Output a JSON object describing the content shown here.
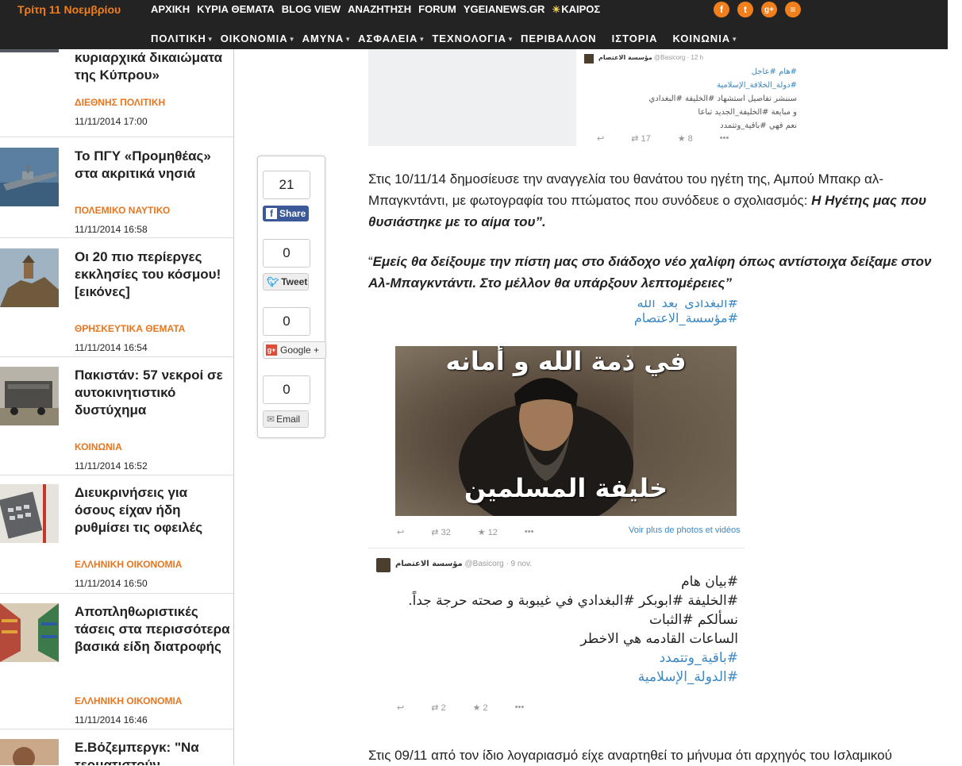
{
  "header": {
    "date": "Τρίτη 11 Νοεμβρίου",
    "nav_top": [
      "ΑΡΧΙΚΗ",
      "ΚΥΡΙΑ ΘΕΜΑΤΑ",
      "BLOG VIEW",
      "ΑΝΑΖΗΤΗΣΗ",
      "FORUM",
      "YGEIANEWS.GR"
    ],
    "weather": "ΚΑΙΡΟΣ",
    "social": [
      {
        "icon": "facebook-icon",
        "glyph": "f"
      },
      {
        "icon": "twitter-icon",
        "glyph": "t"
      },
      {
        "icon": "googleplus-icon",
        "glyph": "g+"
      },
      {
        "icon": "rss-icon",
        "glyph": "≡"
      }
    ],
    "nav_main": [
      {
        "label": "ΠΟΛΙΤΙΚΗ",
        "dropdown": true
      },
      {
        "label": "ΟΙΚΟΝΟΜΙΑ",
        "dropdown": true
      },
      {
        "label": "ΑΜΥΝΑ",
        "dropdown": true
      },
      {
        "label": "ΑΣΦΑΛΕΙΑ",
        "dropdown": true
      },
      {
        "label": "ΤΕΧΝΟΛΟΓΙΑ",
        "dropdown": true
      },
      {
        "label": "ΠΕΡΙΒΑΛΛΟΝ",
        "dropdown": false
      },
      {
        "label": "ΙΣΤΟΡΙΑ",
        "dropdown": false
      },
      {
        "label": "ΚΟΙΝΩΝΙΑ",
        "dropdown": true
      }
    ]
  },
  "sidebar": {
    "items": [
      {
        "title": "κυριαρχικά δικαιώματα της Κύπρου»",
        "category": "ΔΙΕΘΝΗΣ ΠΟΛΙΤΙΚΗ",
        "date": "11/11/2014 17:00",
        "thumb": "ship"
      },
      {
        "title": "Το ΠΓΥ «Προμηθέας» στα ακριτικά νησιά",
        "category": "ΠΟΛΕΜΙΚΟ ΝΑΥΤΙΚΟ",
        "date": "11/11/2014 16:58",
        "thumb": "warship"
      },
      {
        "title": "Οι 20 πιο περίεργες εκκλησίες του κόσμου! [εικόνες]",
        "category": "ΘΡΗΣΚΕΥΤΙΚΑ ΘΕΜΑΤΑ",
        "date": "11/11/2014 16:54",
        "thumb": "church"
      },
      {
        "title": "Πακιστάν: 57 νεκροί σε αυτοκινητιστικό δυστύχημα",
        "category": "ΚΟΙΝΩΝΙΑ",
        "date": "11/11/2014 16:52",
        "thumb": "truck"
      },
      {
        "title": "Διευκρινήσεις για όσους είχαν ήδη ρυθμίσει τις οφειλές",
        "category": "ΕΛΛΗΝΙΚΗ ΟΙΚΟΝΟΜΙΑ",
        "date": "11/11/2014 16:50",
        "thumb": "calculator"
      },
      {
        "title": "Αποπληθωριστικές τάσεις στα περισσότερα βασικά είδη διατροφής",
        "category": "ΕΛΛΗΝΙΚΗ ΟΙΚΟΝΟΜΙΑ",
        "date": "11/11/2014 16:46",
        "thumb": "supermarket"
      },
      {
        "title": "Ε.Βόζεμπεργκ: \"Να τερματιστούν",
        "category": "",
        "date": "",
        "thumb": "person"
      }
    ]
  },
  "share": {
    "facebook_count": "21",
    "facebook_label": "Share",
    "twitter_count": "0",
    "twitter_label": "Tweet",
    "google_count": "0",
    "google_label": "Google +",
    "email_count": "0",
    "email_label": "Email"
  },
  "article": {
    "tweet1": {
      "account": "مؤسسة الاعتصام",
      "handle": "@Basicorg · 12 h",
      "lines": [
        "#هام #عاجل",
        "#دولة_الخلافة_الإسلامية",
        "سننشر تفاصيل استشهاد #الخليفة #البغدادي",
        "و مبايعة #الخليفة_الجديد تباعا",
        "نعم فهي #باقية_وتتمدد"
      ],
      "retweets": "17",
      "favorites": "8"
    },
    "para1_text": "Στις 10/11/14 δημοσίευσε την αναγγελία του θανάτου  του ηγέτη της, Αμπού Μπακρ αλ-Μπαγκντάντι, με φωτογραφία του πτώματος που συνόδευε ο σχολιασμός: ",
    "para1_bold": "Η Ηγέτης μας που θυσιάστηκε με το αίμα του”.",
    "quote_open": "“",
    "quote_text": "Εμείς θα δείξουμε την πίστη μας στο διάδοχο νέο χαλίφη όπως αντίστοιχα δείξαμε στον Αλ-Μπαγκντάντι. Στο μέλλον θα υπάρξουν λεπτομέρειες”",
    "tweet2": {
      "top_hashtags": [
        "#البغدادي_بعد_الله",
        "#مؤسسة_الاعتصام"
      ],
      "image_top_text": "في ذمة الله و أمانه",
      "image_bottom_text": "خليفة المسلمين",
      "retweets": "32",
      "favorites": "12",
      "more_media": "Voir plus de photos et vidéos"
    },
    "tweet3": {
      "account": "مؤسسة الاعتصام",
      "handle": "@Basicorg · 9 nov.",
      "lines": [
        "#بيان هام",
        "#الخليفة #ابوبكر #البغدادي في غيبوبة و صحته حرجة جداً.",
        "نسألكم #الثبات",
        "الساعات القادمه هي الاخطر",
        "#باقية_وتتمدد",
        "#الدولة_الإسلامية"
      ],
      "retweets": "2",
      "favorites": "2"
    },
    "para2_text": "Στις 09/11 από τον ίδιο λογαριασμό είχε αναρτηθεί το μήνυμα ότι αρχηγός του Ισλαμικού"
  }
}
